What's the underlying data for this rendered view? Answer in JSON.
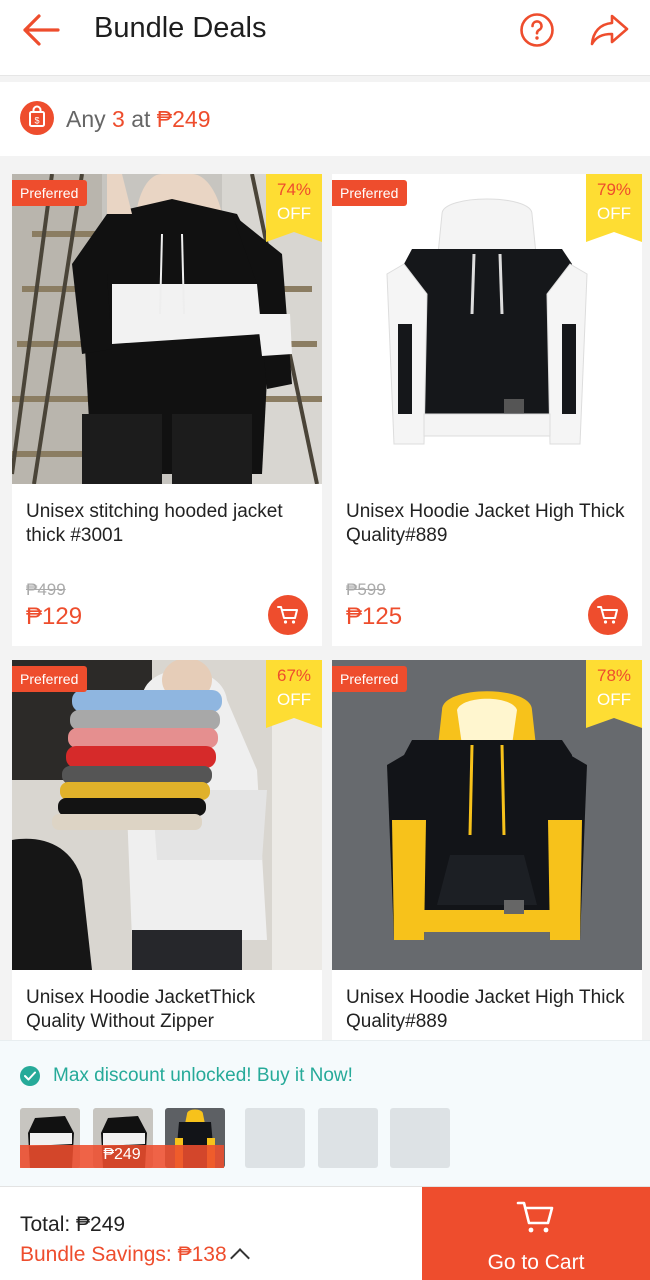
{
  "header": {
    "title": "Bundle Deals",
    "back_icon": "back-arrow-icon",
    "help_icon": "question-circle-icon",
    "share_icon": "share-icon"
  },
  "promo": {
    "prefix": "Any",
    "quantity": "3",
    "middle": "at",
    "price": "₱249",
    "icon": "bundle-bag-icon"
  },
  "products": [
    {
      "badge": "Preferred",
      "discount_pct": "74%",
      "discount_label": "OFF",
      "name": "Unisex stitching hooded jacket thick #3001",
      "original_price": "₱499",
      "price": "₱129"
    },
    {
      "badge": "Preferred",
      "discount_pct": "79%",
      "discount_label": "OFF",
      "name": "Unisex Hoodie Jacket High Thick Quality#889",
      "original_price": "₱599",
      "price": "₱125"
    },
    {
      "badge": "Preferred",
      "discount_pct": "67%",
      "discount_label": "OFF",
      "name": "Unisex Hoodie JacketThick Quality Without Zipper"
    },
    {
      "badge": "Preferred",
      "discount_pct": "78%",
      "discount_label": "OFF",
      "name": "Unisex Hoodie Jacket High Thick Quality#889"
    }
  ],
  "bundle_panel": {
    "message": "Max discount unlocked! Buy it Now!",
    "bundle_price": "₱249",
    "filled_slots": 3,
    "empty_slots": 3
  },
  "footer": {
    "total_label": "Total:",
    "total_value": "₱249",
    "savings_label": "Bundle Savings:",
    "savings_value": "₱138",
    "cart_button": "Go to Cart"
  },
  "colors": {
    "accent": "#ee4d2d",
    "discount_tag": "#fedd33",
    "success": "#26aa99"
  }
}
